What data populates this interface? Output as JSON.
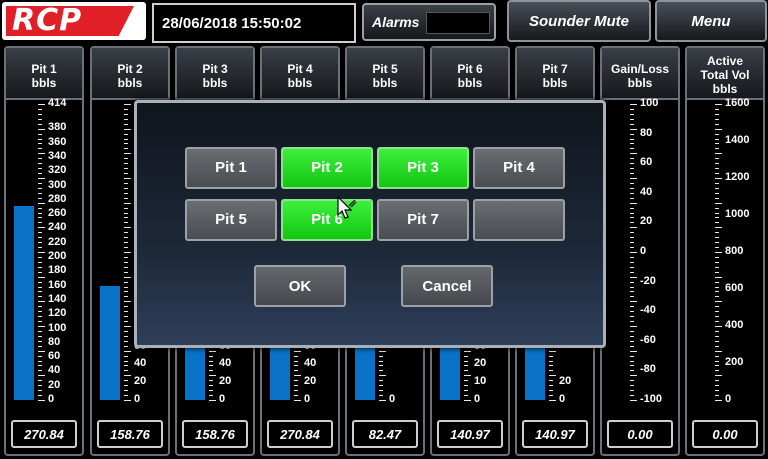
{
  "header": {
    "logo_text": "RCP",
    "datetime": "28/06/2018 15:50:02",
    "alarms_label": "Alarms",
    "sounder_mute_label": "Sounder Mute",
    "menu_label": "Menu"
  },
  "columns": [
    {
      "title": "Pit 1",
      "unit": "bbls",
      "value": "270.84",
      "level": 270.84,
      "ticks": [
        "414",
        "380",
        "360",
        "340",
        "320",
        "300",
        "280",
        "260",
        "240",
        "220",
        "200",
        "180",
        "160",
        "140",
        "120",
        "100",
        "80",
        "60",
        "40",
        "20",
        "0"
      ]
    },
    {
      "title": "Pit 2",
      "unit": "bbls",
      "value": "158.76",
      "level": 158.76,
      "ticks": [
        "60",
        "40",
        "20",
        "0"
      ]
    },
    {
      "title": "Pit 3",
      "unit": "bbls",
      "value": "158.76",
      "level": 158.76,
      "ticks": [
        "60",
        "40",
        "20",
        "0"
      ]
    },
    {
      "title": "Pit 4",
      "unit": "bbls",
      "value": "270.84",
      "level": 270.84,
      "ticks": [
        "60",
        "40",
        "20",
        "0"
      ]
    },
    {
      "title": "Pit 5",
      "unit": "bbls",
      "value": "82.47",
      "level": 82.47,
      "ticks": [
        "0"
      ]
    },
    {
      "title": "Pit 6",
      "unit": "bbls",
      "value": "140.97",
      "level": 140.97,
      "ticks": [
        "30",
        "20",
        "10",
        "0"
      ]
    },
    {
      "title": "Pit 7",
      "unit": "bbls",
      "value": "140.97",
      "level": 140.97,
      "ticks": [
        "20",
        "0"
      ]
    },
    {
      "title": "Gain/Loss",
      "unit": "bbls",
      "value": "0.00",
      "level": 0,
      "ticks": [
        "100",
        "80",
        "60",
        "40",
        "20",
        "0",
        "-20",
        "-40",
        "-60",
        "-80",
        "-100"
      ]
    },
    {
      "title": "Active",
      "title2": "Total Vol",
      "unit": "bbls",
      "value": "0.00",
      "level": 0,
      "ticks": [
        "1600",
        "1400",
        "1200",
        "1000",
        "800",
        "600",
        "400",
        "200",
        "0"
      ]
    }
  ],
  "dialog": {
    "pits": [
      {
        "label": "Pit 1",
        "selected": false
      },
      {
        "label": "Pit 2",
        "selected": true
      },
      {
        "label": "Pit 3",
        "selected": true
      },
      {
        "label": "Pit 4",
        "selected": false
      },
      {
        "label": "Pit 5",
        "selected": false
      },
      {
        "label": "Pit 6",
        "selected": true
      },
      {
        "label": "Pit 7",
        "selected": false
      },
      {
        "label": "",
        "selected": false
      }
    ],
    "ok_label": "OK",
    "cancel_label": "Cancel"
  },
  "colors": {
    "bar": "#0a72c8",
    "selected": "#22dd22",
    "logo_red": "#e01f26"
  }
}
